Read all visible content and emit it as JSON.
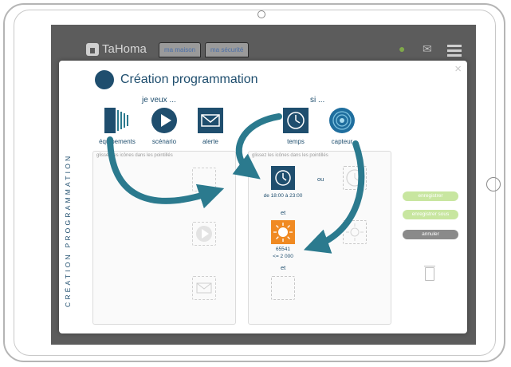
{
  "app": {
    "logo_text": "TaHoma",
    "tabs": [
      "ma maison",
      "ma sécurité"
    ]
  },
  "modal": {
    "title": "Création programmation",
    "vertical_label": "CRÉATION PROGRAMMATION",
    "close_glyph": "×",
    "left_section": {
      "label": "je veux ...",
      "tiles": [
        {
          "label": "équipements",
          "icon": "equipment-icon"
        },
        {
          "label": "scénario",
          "icon": "play-icon"
        },
        {
          "label": "alerte",
          "icon": "envelope-icon"
        }
      ],
      "hint": "glissez les icônes dans les pointillés"
    },
    "right_section": {
      "label": "si ...",
      "tiles": [
        {
          "label": "temps",
          "icon": "clock-icon"
        },
        {
          "label": "capteur",
          "icon": "sensor-icon"
        }
      ],
      "hint": "glissez les icônes dans les pointillés",
      "time_range": "de 18:00 à 23:00",
      "conj_or": "ou",
      "conj_and_1": "et",
      "conj_and_2": "et",
      "sensor_id": "65541",
      "sensor_condition": "<= 2 000"
    },
    "buttons": {
      "save": "enregistrer",
      "save_as": "enregistrer sous",
      "cancel": "annuler"
    }
  },
  "colors": {
    "accent": "#1f4e6e",
    "arrow": "#2b7a8e",
    "sun": "#f08a22",
    "save_green": "#c8e6a0",
    "cancel_gray": "#8a8a8a"
  }
}
